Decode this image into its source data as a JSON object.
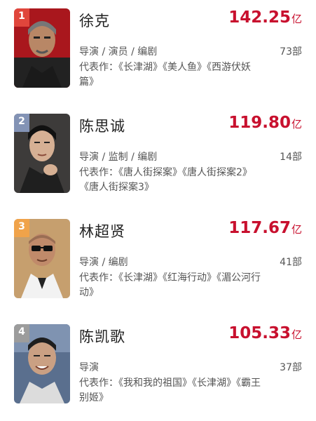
{
  "directors": [
    {
      "rank": "1",
      "badge_color": "#e0463c",
      "name": "徐克",
      "box_office": "142.25",
      "unit": "亿",
      "roles": "导演 / 演员 / 编剧",
      "film_count": "73部",
      "works": "代表作：《长津湖》《美人鱼》《西游伏妖篇》",
      "photo_bg": "#a9171d"
    },
    {
      "rank": "2",
      "badge_color": "#8393b5",
      "name": "陈思诚",
      "box_office": "119.80",
      "unit": "亿",
      "roles": "导演 / 监制 / 编剧",
      "film_count": "14部",
      "works": "代表作：《唐人街探案》《唐人街探案2》《唐人街探案3》",
      "photo_bg": "#3d3b3a"
    },
    {
      "rank": "3",
      "badge_color": "#f0a34a",
      "name": "林超贤",
      "box_office": "117.67",
      "unit": "亿",
      "roles": "导演 / 编剧",
      "film_count": "41部",
      "works": "代表作：《长津湖》《红海行动》《湄公河行动》",
      "photo_bg": "#c69f6e"
    },
    {
      "rank": "4",
      "badge_color": "#9c9c9c",
      "name": "陈凯歌",
      "box_office": "105.33",
      "unit": "亿",
      "roles": "导演",
      "film_count": "37部",
      "works": "代表作：《我和我的祖国》《长津湖》《霸王别姬》",
      "photo_bg": "#5a6f8e"
    }
  ]
}
